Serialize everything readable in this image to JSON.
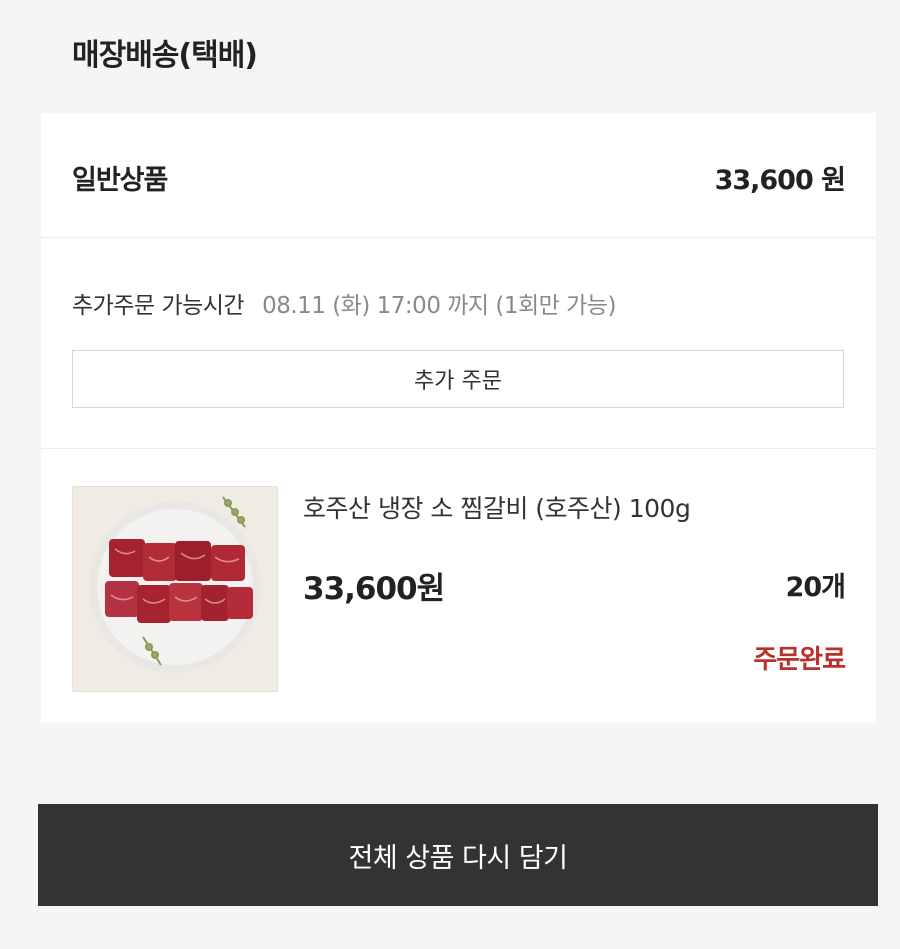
{
  "section": {
    "title": "매장배송(택배)"
  },
  "summary": {
    "label": "일반상품",
    "amount": "33,600 원"
  },
  "extra_order": {
    "label": "추가주문 가능시간",
    "time": "08.11 (화) 17:00 까지 (1회만 가능)",
    "button_label": "추가 주문"
  },
  "product": {
    "image_icon": "beef-short-ribs-plate",
    "name": "호주산 냉장 소 찜갈비 (호주산) 100g",
    "price": "33,600원",
    "quantity": "20개",
    "status": "주문완료",
    "status_color": "#b8312a"
  },
  "footer": {
    "reorder_label": "전체 상품 다시 담기"
  }
}
